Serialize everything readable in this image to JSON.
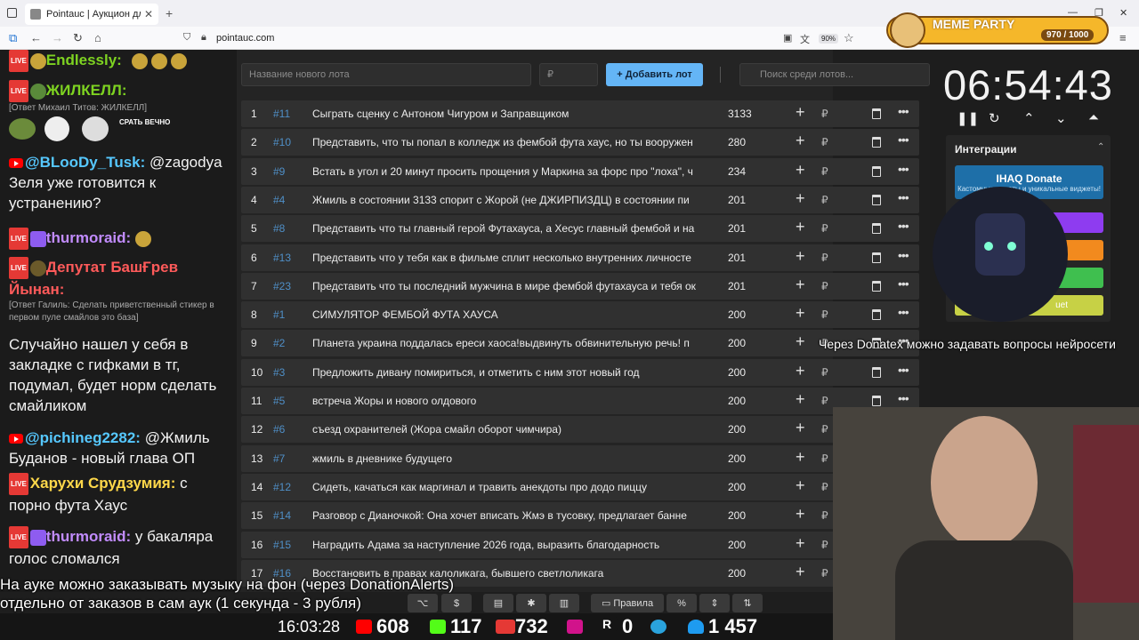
{
  "browser": {
    "tab_title": "Pointauc | Аукцион для стримеров",
    "url": "pointauc.com",
    "zoom": "90%"
  },
  "overlay_meme": {
    "title": "MEME PARTY",
    "count": "970 / 1000"
  },
  "chat": {
    "messages": [
      {
        "nick": "Endlessly:",
        "text": "",
        "nick_color": "#7ed321"
      },
      {
        "nick": "ЖИЛКЕЛЛ:",
        "text": "",
        "nick_color": "#7ed321",
        "reply": "[Ответ Михаил Титов: ЖИЛКЕЛЛ]"
      },
      {
        "nick": "@BLooDy_Tusk:",
        "text": "@zagodya Зеля уже готовится к устранению?",
        "nick_color": "#56c8ff"
      },
      {
        "nick": "thurmoraid:",
        "text": "",
        "nick_color": "#c28cff"
      },
      {
        "nick": "Депутат БашҒрев Йынан:",
        "text": "",
        "nick_color": "#ff5a5a",
        "reply": "[Ответ Галиль: Сделать приветственный стикер в первом пуле смайлов это база]"
      },
      {
        "nick": "",
        "text": "Случайно нашел у себя в закладке с гифками в тг, подумал, будет норм сделать смайликом"
      },
      {
        "nick": "@pichineg2282:",
        "text": "@Жмиль Буданов - новый глава ОП",
        "nick_color": "#56c8ff"
      },
      {
        "nick": "Харухи Срудзумия:",
        "text": "с порно фута Хаус",
        "nick_color": "#ffd84a"
      },
      {
        "nick": "thurmoraid:",
        "text": "у бакаляра голос сломался",
        "nick_color": "#c28cff"
      }
    ],
    "sticker_text": "СРАТЬ ВЕЧНО"
  },
  "auction": {
    "lot_placeholder": "Название нового лота",
    "price_placeholder": "₽",
    "add_button": "Добавить лот",
    "search_placeholder": "Поиск среди лотов...",
    "lots": [
      {
        "idx": "1",
        "num": "#11",
        "name": "Сыграть сценку с Антоном Чигуром и Заправщиком",
        "amount": "3133"
      },
      {
        "idx": "2",
        "num": "#10",
        "name": "Представить, что ты попал в колледж из фембой фута хаус, но ты вооружен",
        "amount": "280"
      },
      {
        "idx": "3",
        "num": "#9",
        "name": "Встать в угол и 20 минут просить прощения у Маркина за форс про \"лоха\", ч",
        "amount": "234"
      },
      {
        "idx": "4",
        "num": "#4",
        "name": "Жмиль в состоянии 3133 спорит с Жорой (не ДЖИРПИЗДЦ) в состоянии пи",
        "amount": "201"
      },
      {
        "idx": "5",
        "num": "#8",
        "name": "Представить что ты главный герой Футахауса, а Хесус главный фембой и на",
        "amount": "201"
      },
      {
        "idx": "6",
        "num": "#13",
        "name": "Представить что у тебя как в фильме сплит несколько внутренних личносте",
        "amount": "201"
      },
      {
        "idx": "7",
        "num": "#23",
        "name": "Представить что ты последний мужчина в мире фембой футахауса и тебя ок",
        "amount": "201"
      },
      {
        "idx": "8",
        "num": "#1",
        "name": "СИМУЛЯТОР ФЕМБОЙ ФУТА ХАУСА",
        "amount": "200"
      },
      {
        "idx": "9",
        "num": "#2",
        "name": "Планета украина поддалась ереси хаоса!выдвинуть обвинительную речь! п",
        "amount": "200"
      },
      {
        "idx": "10",
        "num": "#3",
        "name": "Предложить дивану помириться, и отметить с ним этот новый год",
        "amount": "200"
      },
      {
        "idx": "11",
        "num": "#5",
        "name": "встреча Жоры и нового олдового",
        "amount": "200"
      },
      {
        "idx": "12",
        "num": "#6",
        "name": "съезд охранителей (Жора смайл оборот чимчира)",
        "amount": "200"
      },
      {
        "idx": "13",
        "num": "#7",
        "name": "жмиль в дневнике будущего",
        "amount": "200"
      },
      {
        "idx": "14",
        "num": "#12",
        "name": "Сидеть, качаться как маргинал и травить анекдоты про додо пиццу",
        "amount": "200"
      },
      {
        "idx": "15",
        "num": "#14",
        "name": "Разговор с Дианочкой: Она хочет вписать Жмэ в тусовку, предлагает банне",
        "amount": "200"
      },
      {
        "idx": "16",
        "num": "#15",
        "name": "Наградить Адама за наступление 2026 года, выразить благодарность",
        "amount": "200"
      },
      {
        "idx": "17",
        "num": "#16",
        "name": "Восстановить в правах калоликага, бывшего светлоликага",
        "amount": "200"
      }
    ],
    "currency": "₽"
  },
  "timer": {
    "value": "06:54:43"
  },
  "integrations": {
    "title": "Интеграции",
    "ihaq_title": "IHAQ Donate",
    "ihaq_sub": "Кастомные донаты и уникальные виджеты!",
    "hidden_label": "uet"
  },
  "overlays": {
    "donatex_note": "Через Donatex можно задавать вопросы нейросети",
    "music_line1": "На ауке можно заказывать музыку на фон (через DonationAlerts)",
    "music_line2": "отдельно от заказов в сам аук (1 секунда - 3 рубля)"
  },
  "toolbar": {
    "rules": "Правила",
    "percent": "%",
    "dollar": "$"
  },
  "stats": {
    "time": "16:03:28",
    "youtube": "608",
    "kick": "117",
    "vk": "732",
    "rutube": "0",
    "telegram": "",
    "viewers": "1 457"
  },
  "colors": {
    "accent": "#64b5f6",
    "lot_number": "#4f8fc7"
  }
}
